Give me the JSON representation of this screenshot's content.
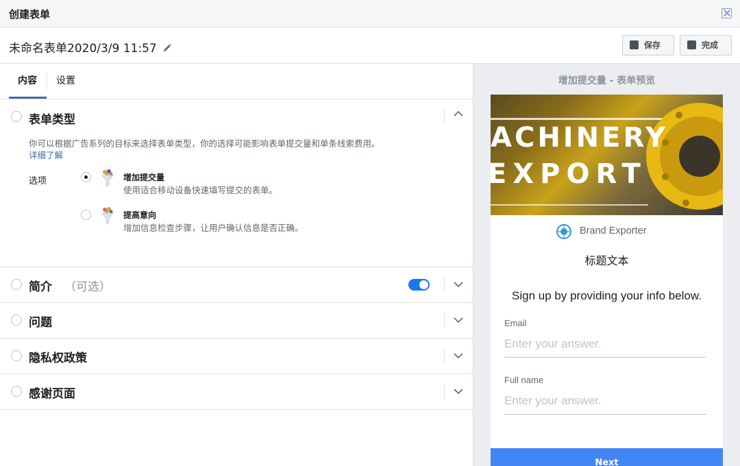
{
  "window": {
    "title": "创建表单"
  },
  "form": {
    "name": "未命名表单2020/3/9 11:57",
    "save_label": "保存",
    "done_label": "完成"
  },
  "tabs": [
    {
      "label": "内容"
    },
    {
      "label": "设置"
    }
  ],
  "form_type": {
    "title": "表单类型",
    "description": "你可以根据广告系列的目标来选择表单类型，你的选择可能影响表单提交量和单条线索费用。",
    "learn_more": "详细了解",
    "options_label": "选项",
    "options": [
      {
        "title": "增加提交量",
        "subtitle": "使用适合移动设备快速填写提交的表单。",
        "selected": true
      },
      {
        "title": "提高意向",
        "subtitle": "增加信息检查步骤，让用户确认信息是否正确。",
        "selected": false
      }
    ]
  },
  "sections": [
    {
      "title": "简介",
      "optional": "（可选）",
      "toggle_on": true
    },
    {
      "title": "问题"
    },
    {
      "title": "隐私权政策"
    },
    {
      "title": "感谢页面"
    }
  ],
  "preview": {
    "title": "增加提交量 - 表单预览",
    "hero_line1": "ACHINERY",
    "hero_line2": "EXPORT",
    "brand": "Brand Exporter",
    "headline": "标题文本",
    "intro": "Sign up by providing your info below.",
    "fields": [
      {
        "label": "Email",
        "placeholder": "Enter your answer."
      },
      {
        "label": "Full name",
        "placeholder": "Enter your answer."
      }
    ],
    "next_label": "Next"
  },
  "colors": {
    "accent": "#4267b2",
    "toggle": "#1877f2",
    "next_button": "#4285f4"
  },
  "icons": [
    "close-icon",
    "pencil-icon",
    "save-icon",
    "done-icon",
    "chevron-up-icon",
    "chevron-down-icon",
    "funnel-icon",
    "globe-icon"
  ]
}
